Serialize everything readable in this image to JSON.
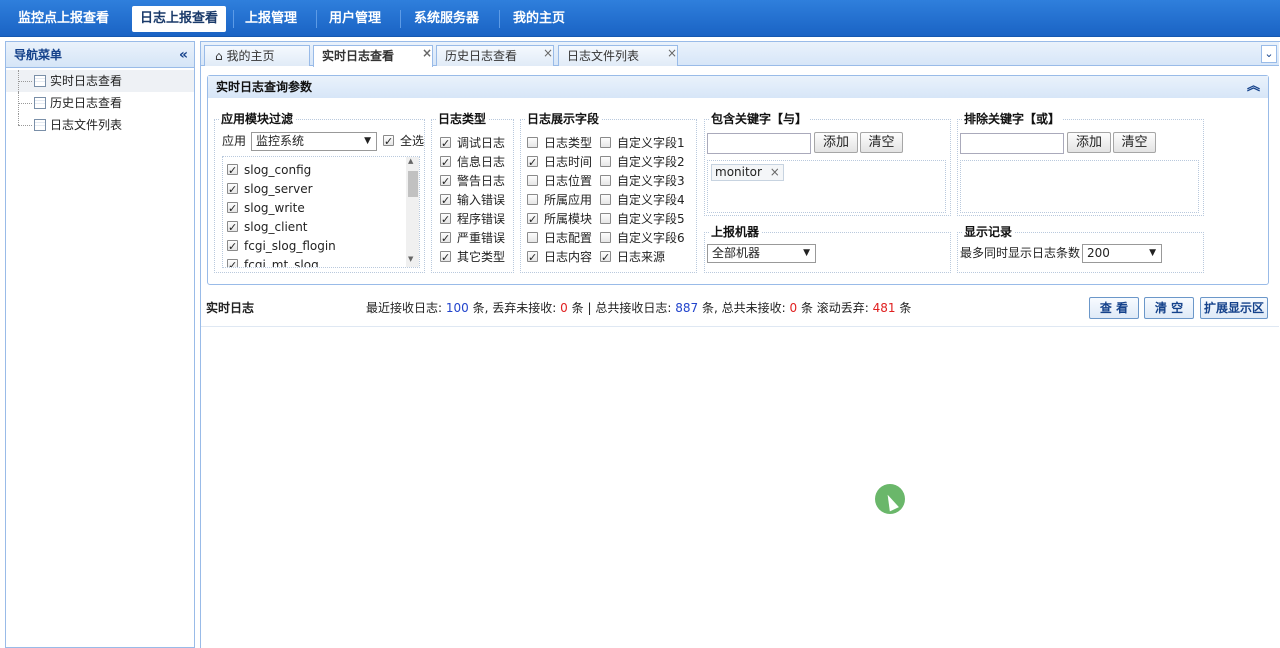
{
  "topnav": {
    "items": [
      "监控点上报查看",
      "日志上报查看",
      "上报管理",
      "用户管理",
      "系统服务器",
      "我的主页"
    ],
    "active_index": 1
  },
  "sidebar": {
    "title": "导航菜单",
    "collapse_icon": "double-chevron-left-icon",
    "items": [
      {
        "label": "实时日志查看",
        "selected": true
      },
      {
        "label": "历史日志查看",
        "selected": false
      },
      {
        "label": "日志文件列表",
        "selected": false
      }
    ]
  },
  "tabs": [
    {
      "label": "我的主页",
      "icon": "home-icon",
      "closable": false,
      "active": false
    },
    {
      "label": "实时日志查看",
      "closable": true,
      "active": true
    },
    {
      "label": "历史日志查看",
      "closable": true,
      "active": false
    },
    {
      "label": "日志文件列表",
      "closable": true,
      "active": false
    }
  ],
  "query_panel": {
    "title": "实时日志查询参数",
    "module_filter": {
      "title": "应用模块过滤",
      "app_label": "应用",
      "app_select": "监控系统",
      "select_all_label": "全选",
      "select_all_checked": true,
      "modules": [
        {
          "label": "slog_config",
          "checked": true
        },
        {
          "label": "slog_server",
          "checked": true
        },
        {
          "label": "slog_write",
          "checked": true
        },
        {
          "label": "slog_client",
          "checked": true
        },
        {
          "label": "fcgi_slog_flogin",
          "checked": true
        },
        {
          "label": "fcgi_mt_slog",
          "checked": true
        }
      ]
    },
    "log_type": {
      "title": "日志类型",
      "items": [
        {
          "label": "调试日志",
          "checked": true
        },
        {
          "label": "信息日志",
          "checked": true
        },
        {
          "label": "警告日志",
          "checked": true
        },
        {
          "label": "输入错误",
          "checked": true
        },
        {
          "label": "程序错误",
          "checked": true
        },
        {
          "label": "严重错误",
          "checked": true
        },
        {
          "label": "其它类型",
          "checked": true
        }
      ]
    },
    "display_fields": {
      "title": "日志展示字段",
      "col1": [
        {
          "label": "日志类型",
          "checked": false
        },
        {
          "label": "日志时间",
          "checked": true
        },
        {
          "label": "日志位置",
          "checked": false
        },
        {
          "label": "所属应用",
          "checked": false
        },
        {
          "label": "所属模块",
          "checked": true
        },
        {
          "label": "日志配置",
          "checked": false
        },
        {
          "label": "日志内容",
          "checked": true
        }
      ],
      "col2": [
        {
          "label": "自定义字段1",
          "checked": false
        },
        {
          "label": "自定义字段2",
          "checked": false
        },
        {
          "label": "自定义字段3",
          "checked": false
        },
        {
          "label": "自定义字段4",
          "checked": false
        },
        {
          "label": "自定义字段5",
          "checked": false
        },
        {
          "label": "自定义字段6",
          "checked": false
        },
        {
          "label": "日志来源",
          "checked": true
        }
      ]
    },
    "include_keywords": {
      "title": "包含关键字【与】",
      "input_value": "",
      "add_label": "添加",
      "clear_label": "清空",
      "tags": [
        "monitor"
      ]
    },
    "exclude_keywords": {
      "title": "排除关键字【或】",
      "input_value": "",
      "add_label": "添加",
      "clear_label": "清空",
      "tags": []
    },
    "machine": {
      "title": "上报机器",
      "select": "全部机器"
    },
    "display_records": {
      "title": "显示记录",
      "label": "最多同时显示日志条数",
      "select": "200"
    }
  },
  "status": {
    "title": "实时日志",
    "recent_label": "最近接收日志:",
    "recent_value": "100",
    "unit": "条",
    "dropped_label": "丢弃未接收:",
    "dropped_value": "0",
    "sep": "|",
    "total_label": "总共接收日志:",
    "total_value": "887",
    "total_dropped_label": "总共未接收:",
    "total_dropped_value": "0",
    "scroll_dropped_label": "滚动丢弃:",
    "scroll_dropped_value": "481",
    "view_label": "查 看",
    "clear_label": "清 空",
    "expand_label": "扩展显示区"
  }
}
